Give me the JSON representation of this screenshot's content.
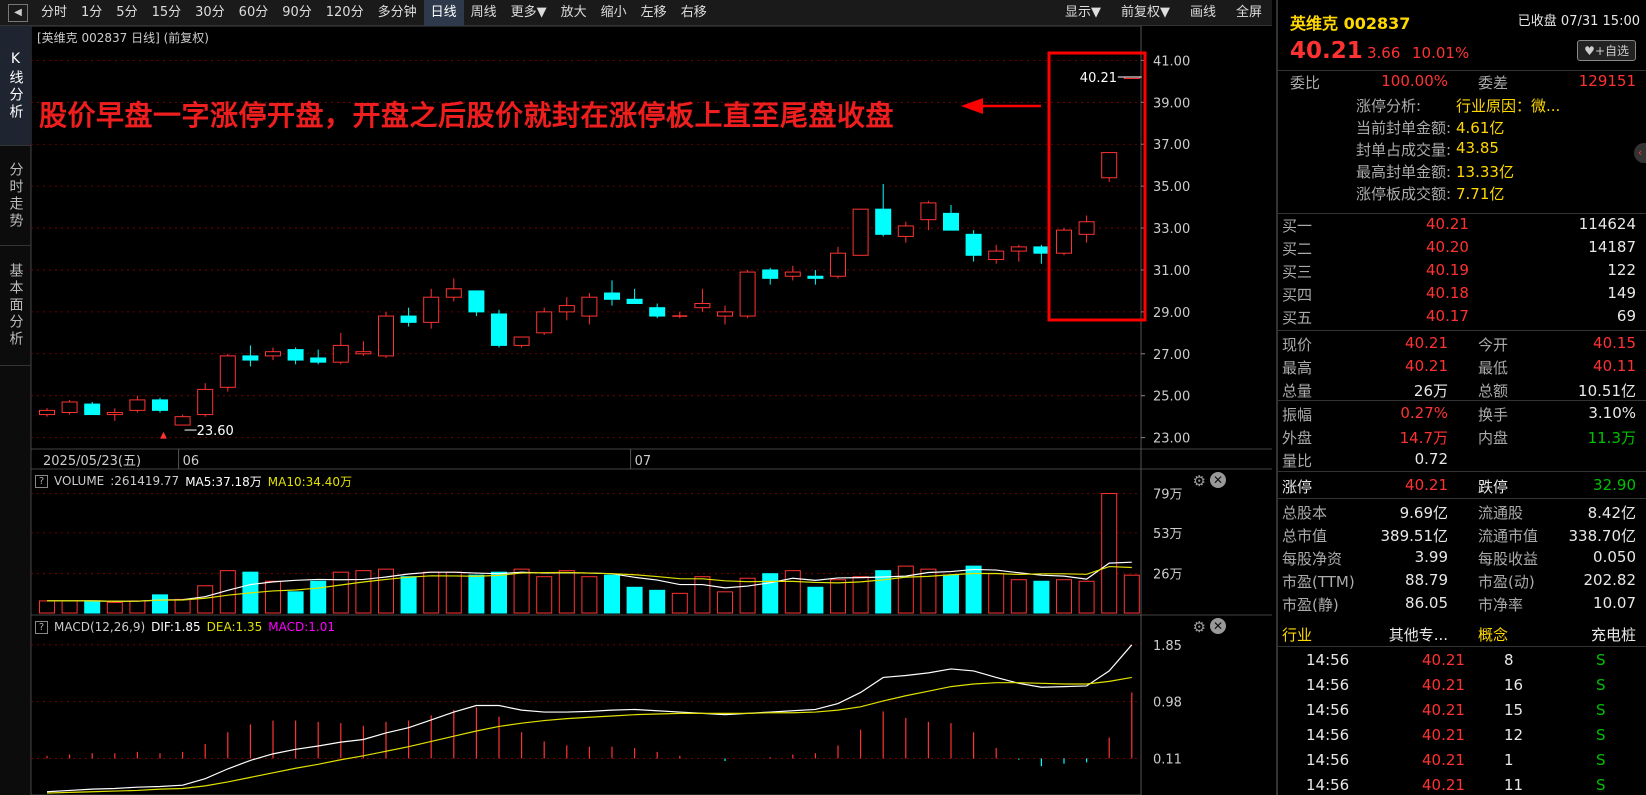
{
  "toolbar": {
    "items": [
      "分时",
      "1分",
      "5分",
      "15分",
      "30分",
      "60分",
      "90分",
      "120分",
      "多分钟",
      "日线",
      "周线",
      "更多▼",
      "放大",
      "缩小",
      "左移",
      "右移"
    ],
    "selected": "日线",
    "right_items": [
      "显示▼",
      "前复权▼",
      "画线",
      "全屏"
    ],
    "back_icon": "◀"
  },
  "left_tabs": [
    "K线分析",
    "分时走势",
    "基本面分析"
  ],
  "chart": {
    "title": "[英维克 002837 日线] (前复权)",
    "annotation": "股价早盘一字涨停开盘，开盘之后股价就封在涨停板上直至尾盘收盘",
    "last_label": "40.21",
    "low_label": "23.60",
    "date_labels": [
      "2025/05/23(五)",
      "06",
      "07"
    ],
    "volume_header": {
      "name": "VOLUME",
      "value": ":261419.77",
      "ma5": "MA5:37.18万",
      "ma10": "MA10:34.40万"
    },
    "macd_header": {
      "name": "MACD(12,26,9)",
      "dif": "DIF:1.85",
      "dea": "DEA:1.35",
      "macd": "MACD:1.01"
    },
    "colors": {
      "up": "#ff3232",
      "down": "#00ffff",
      "ma5": "#ffffff",
      "ma10": "#e0e000",
      "grid": "#8b0000",
      "highlight_box": "#ff0000",
      "macd_label": "#ff00ff"
    }
  },
  "chart_data": [
    {
      "type": "candlestick",
      "title": "英维克 002837 日线",
      "y_ticks": [
        "41.00",
        "39.00",
        "37.00",
        "35.00",
        "33.00",
        "31.00",
        "29.00",
        "27.00",
        "25.00",
        "23.00"
      ],
      "ylim": [
        22.6,
        41.4
      ],
      "ohlc": [
        [
          24.1,
          24.4,
          24.0,
          24.3
        ],
        [
          24.2,
          24.8,
          24.1,
          24.7
        ],
        [
          24.6,
          24.7,
          24.1,
          24.1
        ],
        [
          24.1,
          24.4,
          23.8,
          24.2
        ],
        [
          24.3,
          25.0,
          24.2,
          24.8
        ],
        [
          24.8,
          24.9,
          24.2,
          24.3
        ],
        [
          23.6,
          24.1,
          23.6,
          24.0
        ],
        [
          24.1,
          25.6,
          24.0,
          25.3
        ],
        [
          25.4,
          27.0,
          25.2,
          26.9
        ],
        [
          26.9,
          27.4,
          26.4,
          26.7
        ],
        [
          26.9,
          27.3,
          26.7,
          27.1
        ],
        [
          27.2,
          27.3,
          26.5,
          26.7
        ],
        [
          26.8,
          27.2,
          26.5,
          26.6
        ],
        [
          26.6,
          28.0,
          26.5,
          27.4
        ],
        [
          27.0,
          27.6,
          26.9,
          27.1
        ],
        [
          26.9,
          29.0,
          26.8,
          28.8
        ],
        [
          28.8,
          29.2,
          28.3,
          28.5
        ],
        [
          28.5,
          30.1,
          28.2,
          29.7
        ],
        [
          29.7,
          30.6,
          29.5,
          30.1
        ],
        [
          30.0,
          30.0,
          28.8,
          29.0
        ],
        [
          28.9,
          29.1,
          27.3,
          27.4
        ],
        [
          27.4,
          27.8,
          27.3,
          27.8
        ],
        [
          28.0,
          29.2,
          27.9,
          29.0
        ],
        [
          29.0,
          29.7,
          28.6,
          29.3
        ],
        [
          28.8,
          29.9,
          28.4,
          29.7
        ],
        [
          29.9,
          30.5,
          29.3,
          29.6
        ],
        [
          29.6,
          30.1,
          29.4,
          29.4
        ],
        [
          29.2,
          29.4,
          28.7,
          28.8
        ],
        [
          28.8,
          29.0,
          28.7,
          28.8
        ],
        [
          29.2,
          30.1,
          29.0,
          29.4
        ],
        [
          28.8,
          29.3,
          28.4,
          29.0
        ],
        [
          28.8,
          31.0,
          28.7,
          30.9
        ],
        [
          31.0,
          31.1,
          30.3,
          30.6
        ],
        [
          30.7,
          31.2,
          30.5,
          30.9
        ],
        [
          30.7,
          31.0,
          30.3,
          30.6
        ],
        [
          30.7,
          32.1,
          30.6,
          31.8
        ],
        [
          31.7,
          33.9,
          31.7,
          33.9
        ],
        [
          33.9,
          35.1,
          32.6,
          32.7
        ],
        [
          32.6,
          33.3,
          32.3,
          33.1
        ],
        [
          33.4,
          34.3,
          32.9,
          34.2
        ],
        [
          33.7,
          34.1,
          32.9,
          32.9
        ],
        [
          32.7,
          32.9,
          31.4,
          31.7
        ],
        [
          31.5,
          32.2,
          31.3,
          31.9
        ],
        [
          31.9,
          32.2,
          31.4,
          32.1
        ],
        [
          32.1,
          32.2,
          31.3,
          31.8
        ],
        [
          31.8,
          33.0,
          31.7,
          32.9
        ],
        [
          32.7,
          33.6,
          32.3,
          33.3
        ],
        [
          35.4,
          36.6,
          35.2,
          36.6
        ],
        [
          40.15,
          40.21,
          40.11,
          40.21
        ]
      ]
    },
    {
      "type": "bar",
      "title": "VOLUME",
      "y_ticks": [
        "79万",
        "53万",
        "26万"
      ],
      "ylim": [
        0,
        82
      ],
      "values": [
        8,
        8,
        8,
        7,
        8,
        12,
        9,
        18,
        28,
        27,
        21,
        14,
        21,
        27,
        28,
        29,
        24,
        27,
        27,
        25,
        27,
        29,
        24,
        28,
        24,
        25,
        17,
        15,
        13,
        24,
        14,
        23,
        26,
        28,
        17,
        22,
        24,
        28,
        31,
        29,
        25,
        31,
        26,
        22,
        21,
        22,
        21,
        79,
        25
      ]
    },
    {
      "type": "line",
      "title": "MACD(12,26,9)",
      "y_ticks": [
        "1.85",
        "0.98",
        "0.11"
      ],
      "ylim": [
        -0.45,
        2.0
      ],
      "series": [
        {
          "name": "DIF",
          "values": [
            -0.4,
            -0.38,
            -0.36,
            -0.35,
            -0.33,
            -0.32,
            -0.3,
            -0.2,
            -0.05,
            0.08,
            0.18,
            0.25,
            0.3,
            0.36,
            0.4,
            0.5,
            0.58,
            0.7,
            0.82,
            0.92,
            0.92,
            0.85,
            0.82,
            0.82,
            0.83,
            0.85,
            0.86,
            0.84,
            0.82,
            0.8,
            0.78,
            0.8,
            0.82,
            0.84,
            0.86,
            0.95,
            1.12,
            1.35,
            1.38,
            1.42,
            1.48,
            1.45,
            1.35,
            1.26,
            1.2,
            1.21,
            1.22,
            1.45,
            1.85
          ]
        },
        {
          "name": "DEA",
          "values": [
            -0.42,
            -0.41,
            -0.4,
            -0.39,
            -0.38,
            -0.36,
            -0.35,
            -0.31,
            -0.25,
            -0.18,
            -0.11,
            -0.04,
            0.02,
            0.09,
            0.15,
            0.22,
            0.29,
            0.37,
            0.45,
            0.53,
            0.6,
            0.65,
            0.69,
            0.72,
            0.74,
            0.76,
            0.78,
            0.79,
            0.8,
            0.8,
            0.8,
            0.8,
            0.81,
            0.81,
            0.82,
            0.85,
            0.9,
            0.99,
            1.07,
            1.14,
            1.21,
            1.25,
            1.27,
            1.27,
            1.26,
            1.25,
            1.25,
            1.29,
            1.35
          ]
        },
        {
          "name": "MACD",
          "values": [
            0.04,
            0.06,
            0.08,
            0.08,
            0.1,
            0.08,
            0.1,
            0.22,
            0.4,
            0.52,
            0.58,
            0.58,
            0.56,
            0.54,
            0.5,
            0.56,
            0.58,
            0.66,
            0.74,
            0.78,
            0.64,
            0.4,
            0.26,
            0.2,
            0.18,
            0.18,
            0.16,
            0.1,
            0.04,
            0.0,
            -0.04,
            0.0,
            0.02,
            0.06,
            0.08,
            0.2,
            0.44,
            0.72,
            0.62,
            0.56,
            0.54,
            0.4,
            0.16,
            -0.02,
            -0.12,
            -0.08,
            -0.06,
            0.32,
            1.01
          ]
        }
      ]
    }
  ],
  "right": {
    "name": "英维克 002837",
    "status": "已收盘 07/31 15:00",
    "price": "40.21",
    "change": "3.66",
    "pct": "10.01%",
    "fav": "+自选",
    "webi": {
      "label": "委比",
      "value": "100.00%",
      "label2": "委差",
      "value2": "129151"
    },
    "limit_info": [
      {
        "label": "涨停分析:",
        "value": "行业原因：微..."
      },
      {
        "label": "当前封单金额:",
        "value": "4.61亿"
      },
      {
        "label": "封单占成交量:",
        "value": "43.85"
      },
      {
        "label": "最高封单金额:",
        "value": "13.33亿"
      },
      {
        "label": "涨停板成交额:",
        "value": "7.71亿"
      }
    ],
    "bids": [
      {
        "label": "买一",
        "price": "40.21",
        "vol": "114624"
      },
      {
        "label": "买二",
        "price": "40.20",
        "vol": "14187"
      },
      {
        "label": "买三",
        "price": "40.19",
        "vol": "122"
      },
      {
        "label": "买四",
        "price": "40.18",
        "vol": "149"
      },
      {
        "label": "买五",
        "price": "40.17",
        "vol": "69"
      }
    ],
    "quote": [
      {
        "l1": "现价",
        "v1": "40.21",
        "l2": "今开",
        "v2": "40.15"
      },
      {
        "l1": "最高",
        "v1": "40.21",
        "l2": "最低",
        "v2": "40.11"
      },
      {
        "l1": "总量",
        "v1": "26万",
        "l2": "总额",
        "v2": "10.51亿"
      }
    ],
    "amp": [
      {
        "l1": "振幅",
        "v1": "0.27%",
        "l2": "换手",
        "v2": "3.10%"
      },
      {
        "l1": "外盘",
        "v1": "14.7万",
        "l2": "内盘",
        "v2": "11.3万"
      },
      {
        "l1": "量比",
        "v1": "0.72",
        "l2": "",
        "v2": ""
      }
    ],
    "limits": {
      "l1": "涨停",
      "v1": "40.21",
      "l2": "跌停",
      "v2": "32.90"
    },
    "fund": [
      {
        "l1": "总股本",
        "v1": "9.69亿",
        "l2": "流通股",
        "v2": "8.42亿"
      },
      {
        "l1": "总市值",
        "v1": "389.51亿",
        "l2": "流通市值",
        "v2": "338.70亿"
      },
      {
        "l1": "每股净资",
        "v1": "3.99",
        "l2": "每股收益",
        "v2": "0.050"
      },
      {
        "l1": "市盈(TTM)",
        "v1": "88.79",
        "l2": "市盈(动)",
        "v2": "202.82"
      },
      {
        "l1": "市盈(静)",
        "v1": "86.05",
        "l2": "市净率",
        "v2": "10.07"
      }
    ],
    "industry": {
      "l1": "行业",
      "v1": "其他专...",
      "l2": "概念",
      "v2": "充电桩"
    },
    "ticks": [
      {
        "time": "14:56",
        "price": "40.21",
        "vol": "8",
        "side": "S"
      },
      {
        "time": "14:56",
        "price": "40.21",
        "vol": "16",
        "side": "S"
      },
      {
        "time": "14:56",
        "price": "40.21",
        "vol": "15",
        "side": "S"
      },
      {
        "time": "14:56",
        "price": "40.21",
        "vol": "12",
        "side": "S"
      },
      {
        "time": "14:56",
        "price": "40.21",
        "vol": "1",
        "side": "S"
      },
      {
        "time": "14:56",
        "price": "40.21",
        "vol": "11",
        "side": "S"
      }
    ]
  }
}
